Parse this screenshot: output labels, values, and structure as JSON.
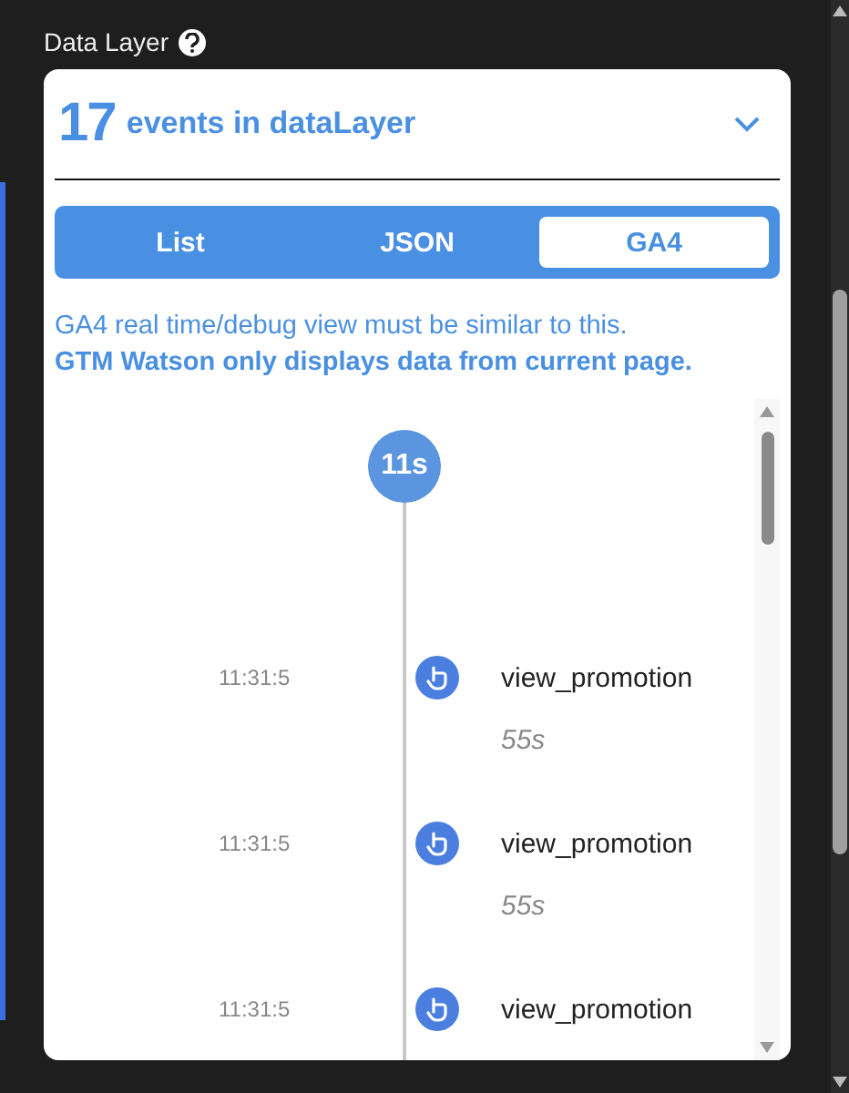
{
  "panel": {
    "title": "Data Layer"
  },
  "card": {
    "count": "17",
    "count_label": "events in dataLayer",
    "expanded": true
  },
  "tabs": [
    {
      "label": "List",
      "selected": false
    },
    {
      "label": "JSON",
      "selected": false
    },
    {
      "label": "GA4",
      "selected": true
    }
  ],
  "notice": {
    "text": "GA4 real time/debug view must be similar to this.",
    "emphasis": "GTM Watson only displays data from current page."
  },
  "timeline": {
    "marker": "11s",
    "events": [
      {
        "time": "11:31:5",
        "name": "view_promotion",
        "duration": "55s"
      },
      {
        "time": "11:31:5",
        "name": "view_promotion",
        "duration": "55s"
      },
      {
        "time": "11:31:5",
        "name": "view_promotion"
      }
    ]
  }
}
